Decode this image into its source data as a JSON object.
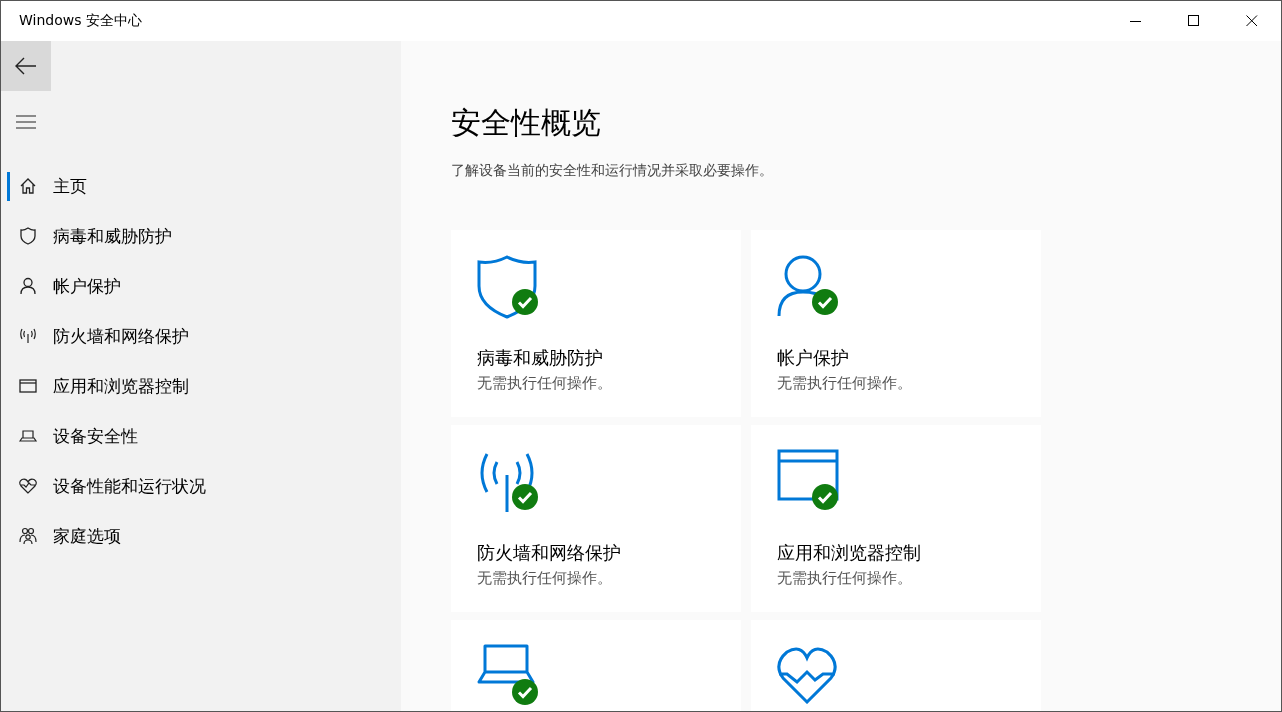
{
  "window": {
    "title": "Windows 安全中心"
  },
  "sidebar": {
    "items": [
      {
        "label": "主页",
        "kind": "home",
        "selected": true
      },
      {
        "label": "病毒和威胁防护",
        "kind": "shield",
        "selected": false
      },
      {
        "label": "帐户保护",
        "kind": "person",
        "selected": false
      },
      {
        "label": "防火墙和网络保护",
        "kind": "antenna",
        "selected": false
      },
      {
        "label": "应用和浏览器控制",
        "kind": "window",
        "selected": false
      },
      {
        "label": "设备安全性",
        "kind": "laptop",
        "selected": false
      },
      {
        "label": "设备性能和运行状况",
        "kind": "heart",
        "selected": false
      },
      {
        "label": "家庭选项",
        "kind": "family",
        "selected": false
      }
    ]
  },
  "main": {
    "title": "安全性概览",
    "subtitle": "了解设备当前的安全性和运行情况并采取必要操作。",
    "cards": [
      {
        "kind": "shield",
        "title": "病毒和威胁防护",
        "status": "无需执行任何操作。",
        "ok": true
      },
      {
        "kind": "person",
        "title": "帐户保护",
        "status": "无需执行任何操作。",
        "ok": true
      },
      {
        "kind": "antenna",
        "title": "防火墙和网络保护",
        "status": "无需执行任何操作。",
        "ok": true
      },
      {
        "kind": "window",
        "title": "应用和浏览器控制",
        "status": "无需执行任何操作。",
        "ok": true
      },
      {
        "kind": "laptop",
        "ok": true
      },
      {
        "kind": "heart",
        "ok": false
      }
    ]
  }
}
